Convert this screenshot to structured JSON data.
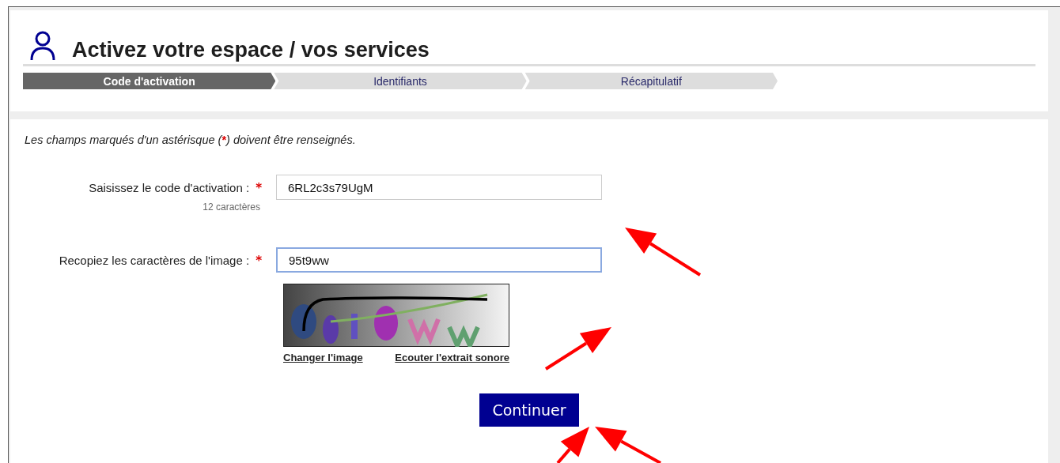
{
  "header": {
    "title": "Activez votre espace / vos services"
  },
  "steps": [
    {
      "label": "Code d'activation",
      "selected": true
    },
    {
      "label": "Identifiants",
      "selected": false
    },
    {
      "label": "Récapitulatif",
      "selected": false
    }
  ],
  "required_note": {
    "before": "Les champs marqués d'un astérisque (",
    "mark": "*",
    "after": ") doivent être renseignés."
  },
  "fields": [
    {
      "label": "Saisissez le code d'activation :",
      "required": true,
      "value": "6RL2c3s79UgM",
      "hint": "12 caractères",
      "focused": false
    },
    {
      "label": "Recopiez les caractères de l'image :",
      "required": true,
      "value": "95t9ww",
      "focused": true
    }
  ],
  "captcha": {
    "kind": "picture",
    "links": [
      "Changer l'image",
      "Ecouter l'extrait sonore"
    ]
  },
  "submit_button": "Continuer"
}
